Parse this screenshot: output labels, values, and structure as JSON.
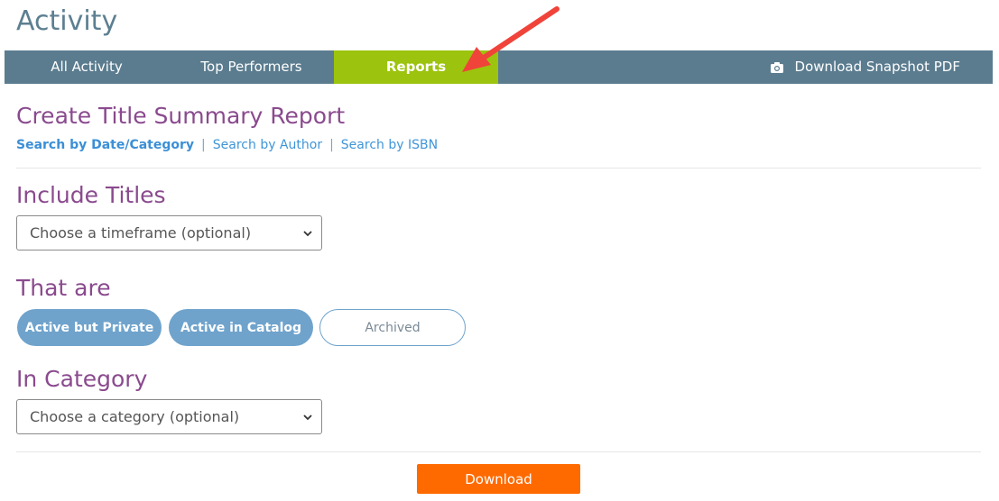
{
  "page": {
    "title": "Activity"
  },
  "nav": {
    "tabs": [
      {
        "label": "All Activity"
      },
      {
        "label": "Top Performers"
      },
      {
        "label": "Reports"
      }
    ],
    "active_tab": "Reports",
    "snapshot_label": "Download Snapshot PDF",
    "snapshot_icon": "camera-icon"
  },
  "report": {
    "title": "Create Title Summary Report",
    "search_links": [
      {
        "label": "Search by Date/Category"
      },
      {
        "label": "Search by Author"
      },
      {
        "label": "Search by ISBN"
      }
    ],
    "separator": "|"
  },
  "include_titles": {
    "heading": "Include Titles",
    "select_value": "Choose a timeframe (optional)"
  },
  "that_are": {
    "heading": "That are",
    "options": [
      {
        "label": "Active but Private",
        "selected": true
      },
      {
        "label": "Active in Catalog",
        "selected": true
      },
      {
        "label": "Archived",
        "selected": false
      }
    ]
  },
  "in_category": {
    "heading": "In Category",
    "select_value": "Choose a category (optional)"
  },
  "download_label": "Download",
  "colors": {
    "nav_bg": "#5b7c8f",
    "active_tab": "#9cc30d",
    "heading": "#8a4a8e",
    "link": "#3f95d8",
    "pill": "#6fa3cc",
    "download": "#ff6a00",
    "arrow": "#f0433a"
  }
}
